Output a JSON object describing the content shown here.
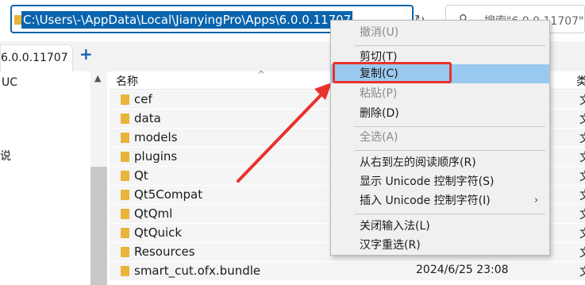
{
  "address": {
    "path": "C:\\Users\\-\\AppData\\Local\\JianyingPro\\Apps\\6.0.0.11707"
  },
  "search": {
    "placeholder_text": "搜索\"6.0.0.11707\""
  },
  "tab": {
    "label": "6.0.0.11707",
    "new_tab": "+"
  },
  "nav": {
    "item1": "UC",
    "item2": "说"
  },
  "list": {
    "col_name": "名称",
    "col_right": "类",
    "rows": [
      {
        "name": "cef",
        "date": "",
        "type": "文"
      },
      {
        "name": "data",
        "date": "",
        "type": "文"
      },
      {
        "name": "models",
        "date": "",
        "type": "文"
      },
      {
        "name": "plugins",
        "date": "",
        "type": "文"
      },
      {
        "name": "Qt",
        "date": "",
        "type": "文"
      },
      {
        "name": "Qt5Compat",
        "date": "",
        "type": "文"
      },
      {
        "name": "QtQml",
        "date": "",
        "type": "文"
      },
      {
        "name": "QtQuick",
        "date": "",
        "type": "文"
      },
      {
        "name": "Resources",
        "date": "",
        "type": "文"
      },
      {
        "name": "smart_cut.ofx.bundle",
        "date": "2024/6/25 23:08",
        "type": "文"
      }
    ]
  },
  "menu": {
    "undo": "撤消(U)",
    "cut": "剪切(T)",
    "copy": "复制(C)",
    "paste": "粘贴(P)",
    "delete": "删除(D)",
    "select_all": "全选(A)",
    "rtl": "从右到左的阅读顺序(R)",
    "show_unicode": "显示 Unicode 控制字符(S)",
    "insert_unicode": "插入 Unicode 控制字符(I)",
    "close_ime": "关闭输入法(L)",
    "reconvert": "汉字重选(R)",
    "submenu_arrow": "›"
  },
  "annotation": {
    "color": "#e8322e"
  }
}
